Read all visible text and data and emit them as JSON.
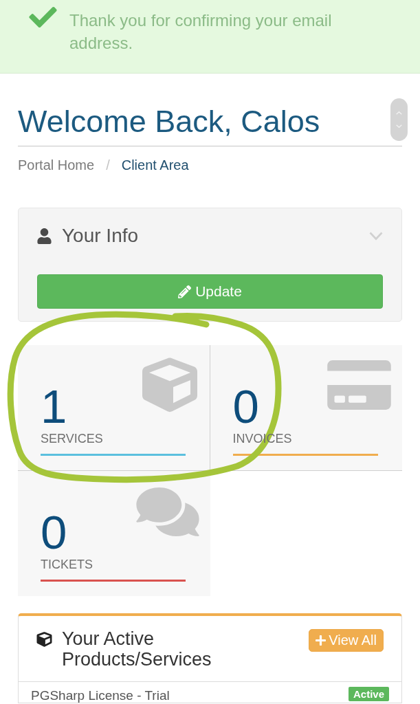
{
  "alert": {
    "message": "Thank you for confirming your email address."
  },
  "header": {
    "title": "Welcome Back, Calos"
  },
  "breadcrumb": {
    "items": [
      {
        "label": "Portal Home",
        "current": false
      },
      {
        "label": "Client Area",
        "current": true
      }
    ],
    "separator": "/"
  },
  "info_panel": {
    "title": "Your Info",
    "button": "Update"
  },
  "tiles": [
    {
      "kind": "services",
      "count": "1",
      "label": "SERVICES",
      "color": "#5bc0de"
    },
    {
      "kind": "invoices",
      "count": "0",
      "label": "INVOICES",
      "color": "#f0ad4e"
    },
    {
      "kind": "tickets",
      "count": "0",
      "label": "TICKETS",
      "color": "#d9534f"
    }
  ],
  "products_panel": {
    "title": "Your Active Products/Services",
    "button": "View All",
    "items": [
      {
        "name": "PGSharp License - Trial",
        "status": "Active"
      }
    ]
  },
  "annotations": [
    {
      "kind": "circle"
    }
  ]
}
